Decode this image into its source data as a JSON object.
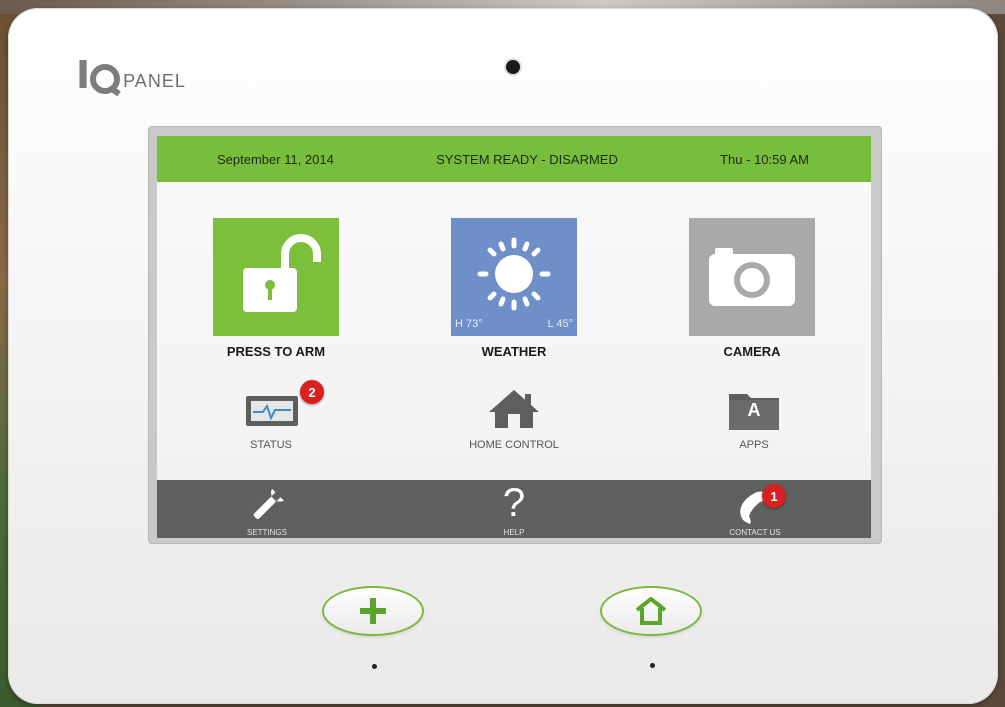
{
  "brand": {
    "logo_text": "PANEL"
  },
  "status_bar": {
    "date": "September 11, 2014",
    "status": "SYSTEM READY - DISARMED",
    "time": "Thu - 10:59 AM"
  },
  "tiles": {
    "arm": {
      "label": "PRESS TO ARM",
      "icon": "open-lock-icon"
    },
    "weather": {
      "label": "WEATHER",
      "high": "H 73°",
      "low": "L 45°",
      "icon": "sun-icon"
    },
    "camera": {
      "label": "CAMERA",
      "icon": "camera-icon"
    }
  },
  "secondary": {
    "status": {
      "label": "STATUS",
      "badge": "2",
      "icon": "monitor-icon"
    },
    "home_control": {
      "label": "HOME CONTROL",
      "icon": "house-icon"
    },
    "apps": {
      "label": "APPS",
      "icon_letter": "A",
      "icon": "apps-folder-icon"
    }
  },
  "bottom_bar": {
    "settings": {
      "label": "SETTINGS",
      "icon": "wrench-icon"
    },
    "help": {
      "label": "HELP",
      "icon": "question-mark-icon",
      "glyph": "?"
    },
    "contact": {
      "label": "CONTACT US",
      "badge": "1",
      "icon": "phone-icon"
    }
  },
  "hardware_buttons": [
    {
      "name": "plus",
      "icon": "plus-icon"
    },
    {
      "name": "home",
      "icon": "home-outline-icon"
    }
  ],
  "colors": {
    "accent_green": "#79bd3c",
    "weather_blue": "#6e8fc8",
    "camera_gray": "#a9a9ab",
    "bottom_bar": "#5f615f",
    "badge_red": "#d82020"
  }
}
